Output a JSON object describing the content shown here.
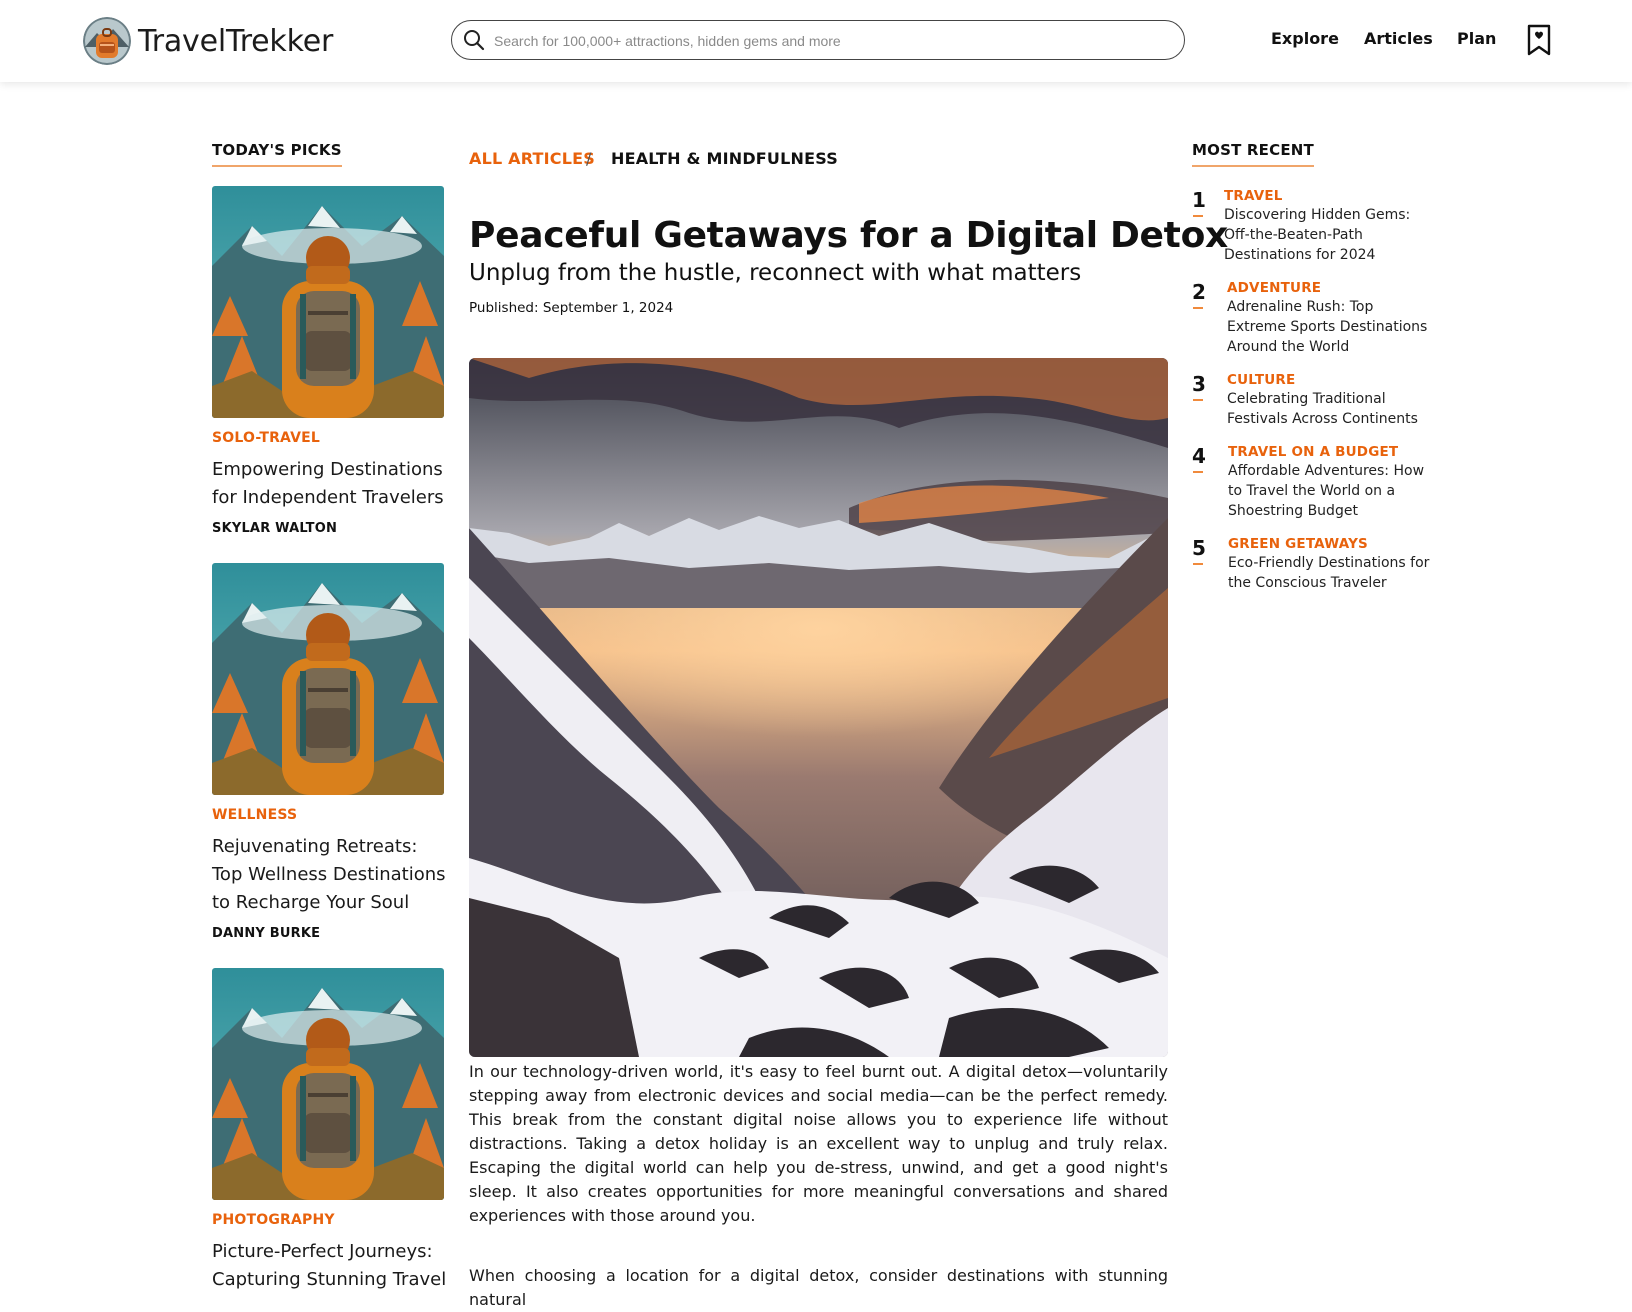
{
  "header": {
    "logo_text": "TravelTrekker",
    "search_placeholder": "Search for 100,000+ attractions, hidden gems and more",
    "nav": [
      "Explore",
      "Articles",
      "Plan"
    ]
  },
  "left": {
    "heading": "TODAY'S PICKS",
    "picks": [
      {
        "category": "SOLO-TRAVEL",
        "title": "Empowering Destinations for Independent Travelers",
        "author": "SKYLAR WALTON"
      },
      {
        "category": "WELLNESS",
        "title": "Rejuvenating Retreats: Top Wellness Destinations to Recharge Your Soul",
        "author": "DANNY BURKE"
      },
      {
        "category": "PHOTOGRAPHY",
        "title": "Picture-Perfect Journeys: Capturing Stunning Travel",
        "author": ""
      }
    ]
  },
  "article": {
    "breadcrumb": {
      "all": "ALL ARTICLES",
      "separator": "/",
      "current": "HEALTH & MINDFULNESS"
    },
    "title": "Peaceful Getaways for a Digital Detox",
    "subtitle": "Unplug from the hustle, reconnect with what matters",
    "published": "Published: September 1, 2024",
    "paragraphs": [
      "In our technology-driven world, it's easy to feel burnt out. A digital detox—voluntarily stepping away from electronic devices and social media—can be the perfect remedy. This break from the constant digital noise allows you to experience life without distractions. Taking a detox holiday is an excellent way to unplug and truly relax. Escaping the digital world can help you de-stress, unwind, and get a good night's sleep. It also creates opportunities for more meaningful conversations and shared experiences with those around you.",
      "When choosing a location for a digital detox, consider destinations with stunning natural"
    ]
  },
  "right": {
    "heading": "MOST RECENT",
    "items": [
      {
        "num": "1",
        "category": "TRAVEL",
        "title": "Discovering Hidden Gems: Off-the-Beaten-Path Destinations for 2024"
      },
      {
        "num": "2",
        "category": "ADVENTURE",
        "title": "Adrenaline Rush: Top Extreme Sports Destinations Around the World"
      },
      {
        "num": "3",
        "category": "CULTURE",
        "title": "Celebrating Traditional Festivals Across Continents"
      },
      {
        "num": "4",
        "category": "TRAVEL ON A BUDGET",
        "title": "Affordable Adventures: How to Travel the World on a Shoestring Budget"
      },
      {
        "num": "5",
        "category": "GREEN GETAWAYS",
        "title": "Eco-Friendly Destinations for the Conscious Traveler"
      }
    ]
  },
  "colors": {
    "accent": "#e8620c",
    "underline": "#f0a56a",
    "text": "#111111"
  },
  "icons": [
    "backpack-logo-icon",
    "search-icon",
    "bookmark-heart-icon"
  ]
}
